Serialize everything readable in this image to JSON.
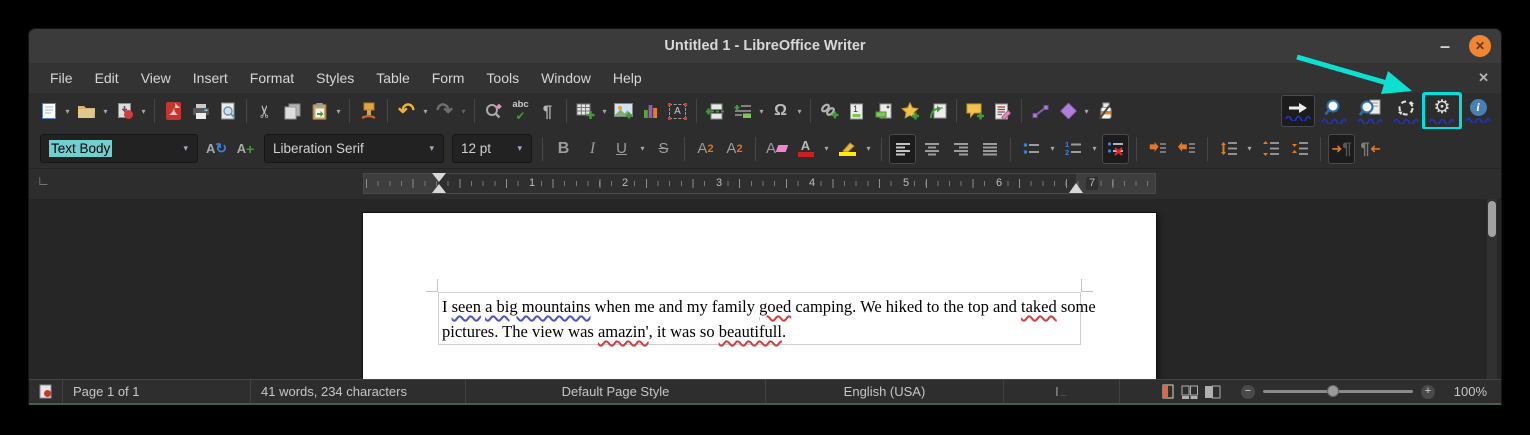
{
  "window": {
    "title": "Untitled 1 - LibreOffice Writer"
  },
  "menu": {
    "items": [
      "File",
      "Edit",
      "View",
      "Insert",
      "Format",
      "Styles",
      "Table",
      "Form",
      "Tools",
      "Window",
      "Help"
    ]
  },
  "toolbar_main_icons": [
    "new-document",
    "open",
    "save",
    "export-pdf",
    "print",
    "print-preview",
    "cut",
    "copy",
    "paste",
    "clone-formatting",
    "undo",
    "redo",
    "find-replace",
    "spelling",
    "formatting-marks",
    "insert-table",
    "insert-image",
    "insert-chart",
    "insert-text-box",
    "insert-page-break",
    "insert-field",
    "insert-special-character",
    "insert-hyperlink",
    "insert-footnote",
    "insert-endnote",
    "insert-bookmark",
    "insert-cross-reference",
    "insert-comment",
    "track-changes",
    "insert-line",
    "basic-shapes",
    "show-draw-functions",
    "lt-autocheck",
    "lt-check-text",
    "lt-check-document",
    "lt-refresh",
    "lt-settings",
    "lt-about"
  ],
  "toolbar_format_icons": [
    "set-paragraph-style",
    "update-style",
    "new-style",
    "font-name",
    "font-size",
    "bold",
    "italic",
    "underline",
    "strikethrough",
    "superscript",
    "subscript",
    "clear-formatting",
    "font-color",
    "highlight-color",
    "align-left",
    "align-center",
    "align-right",
    "justify",
    "unordered-list",
    "ordered-list",
    "no-list",
    "increase-indent",
    "decrease-indent",
    "line-spacing",
    "increase-paragraph-spacing",
    "decrease-paragraph-spacing",
    "left-to-right",
    "right-to-left"
  ],
  "format_bar": {
    "paragraph_style": "Text Body",
    "font_name": "Liberation Serif",
    "font_size": "12 pt"
  },
  "ruler": {
    "numbers": [
      "1",
      "2",
      "3",
      "4",
      "5",
      "6",
      "7"
    ]
  },
  "document": {
    "line1": [
      {
        "text": "I ",
        "mark": "none"
      },
      {
        "text": "seen",
        "mark": "grammar"
      },
      {
        "text": " ",
        "mark": "none"
      },
      {
        "text": "a big mountains",
        "mark": "grammar"
      },
      {
        "text": " when me and my family ",
        "mark": "none"
      },
      {
        "text": "goed",
        "mark": "spelling"
      },
      {
        "text": " camping. We hiked to the top and ",
        "mark": "none"
      },
      {
        "text": "taked",
        "mark": "spelling"
      },
      {
        "text": " some",
        "mark": "none"
      }
    ],
    "line2": [
      {
        "text": "pictures. The view was ",
        "mark": "none"
      },
      {
        "text": "amazin'",
        "mark": "spelling"
      },
      {
        "text": ", it was so ",
        "mark": "none"
      },
      {
        "text": "beautifull",
        "mark": "spelling"
      },
      {
        "text": ".",
        "mark": "none"
      }
    ]
  },
  "status_bar": {
    "page": "Page 1 of 1",
    "words": "41 words, 234 characters",
    "page_style": "Default Page Style",
    "language": "English (USA)",
    "zoom_level": "100%"
  },
  "colors": {
    "annotation_cyan": "#0ce0d0",
    "highlight_box_cyan": "#00e0e0",
    "spelling_red": "#d04040",
    "grammar_blue": "#4a52c8",
    "close_button_orange": "#ef8636",
    "style_selection_cyan": "#6fd0cf"
  },
  "icons": {
    "dropdown": "▾",
    "minimize": "–",
    "close_x": "✕",
    "doc_close_x": "✕",
    "cut": "✂",
    "undo": "↶",
    "redo": "↷",
    "pilcrow": "¶",
    "omega": "Ω",
    "abc": "abc",
    "check": "✔",
    "update_arrow": "↻",
    "plus": "+",
    "bold": "B",
    "italic": "I",
    "underline": "U",
    "strikethrough": "S",
    "letter_a": "A",
    "sup_two": "2",
    "gear": "⚙",
    "info_i": "i",
    "one": "1",
    "two": "2",
    "corner": "∟",
    "ibeam": "I",
    "zoom_out": "−",
    "zoom_in": "+"
  }
}
